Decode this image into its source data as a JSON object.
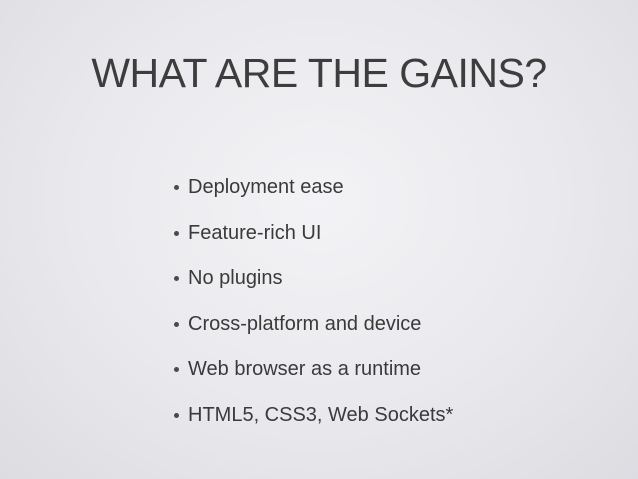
{
  "slide": {
    "title": "WHAT ARE THE GAINS?",
    "bullets": [
      "Deployment ease",
      "Feature-rich UI",
      "No plugins",
      "Cross-platform and device",
      "Web browser as a runtime",
      "HTML5, CSS3, Web Sockets*"
    ]
  }
}
